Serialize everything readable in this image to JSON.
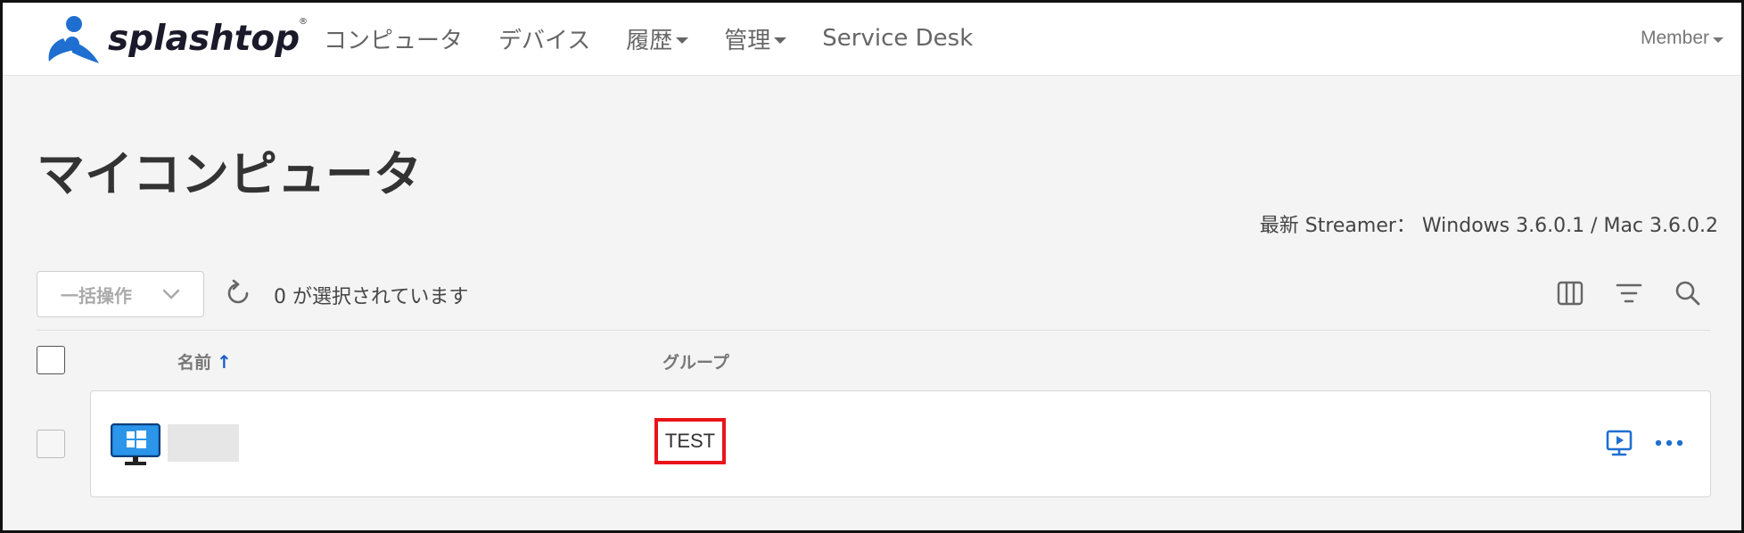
{
  "header": {
    "logo_text": "splashtop",
    "logo_reg": "®",
    "nav": [
      {
        "label": "コンピュータ",
        "has_caret": false
      },
      {
        "label": "デバイス",
        "has_caret": false
      },
      {
        "label": "履歴",
        "has_caret": true
      },
      {
        "label": "管理",
        "has_caret": true
      },
      {
        "label": "Service Desk",
        "has_caret": false
      }
    ],
    "member_label": "Member"
  },
  "page": {
    "title": "マイコンピュータ",
    "streamer_info": "最新 Streamer： Windows 3.6.0.1 / Mac 3.6.0.2"
  },
  "toolbar": {
    "bulk_action_label": "一括操作",
    "selected_count_text": "0 が選択されています"
  },
  "table": {
    "columns": {
      "name": "名前",
      "name_sort_arrow": "↑",
      "group": "グループ"
    },
    "rows": [
      {
        "name": "",
        "group": "TEST",
        "os": "windows"
      }
    ]
  },
  "colors": {
    "brand_blue": "#1f6fd0",
    "logo_dark": "#1a1a2a",
    "highlight_red": "#e8141a",
    "page_bg": "#f4f4f4"
  },
  "icons": [
    "splashtop-logo-icon",
    "refresh-icon",
    "columns-icon",
    "filter-icon",
    "search-icon",
    "windows-monitor-icon",
    "remote-session-icon",
    "more-icon",
    "chevron-down-icon"
  ]
}
